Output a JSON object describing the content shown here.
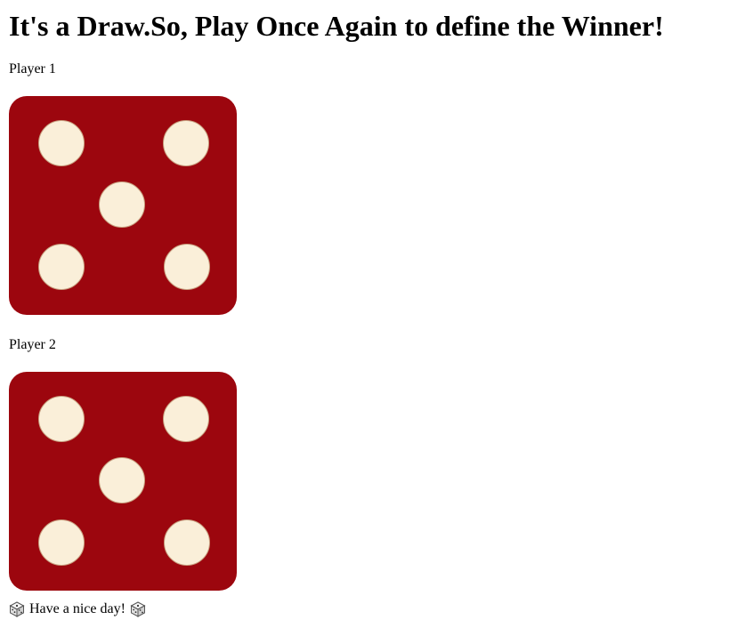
{
  "header": {
    "title": "It's a Draw.So, Play Once Again to define the Winner!"
  },
  "players": [
    {
      "label": "Player 1",
      "die_value": 5,
      "die_icon": "dice-five-icon"
    },
    {
      "label": "Player 2",
      "die_value": 5,
      "die_icon": "dice-five-icon"
    }
  ],
  "footer": {
    "message": "Have a nice day!",
    "left_icon": "dice-icon",
    "right_icon": "dice-icon"
  },
  "colors": {
    "die_face": "#9c060e",
    "pip": "#faefd9"
  }
}
